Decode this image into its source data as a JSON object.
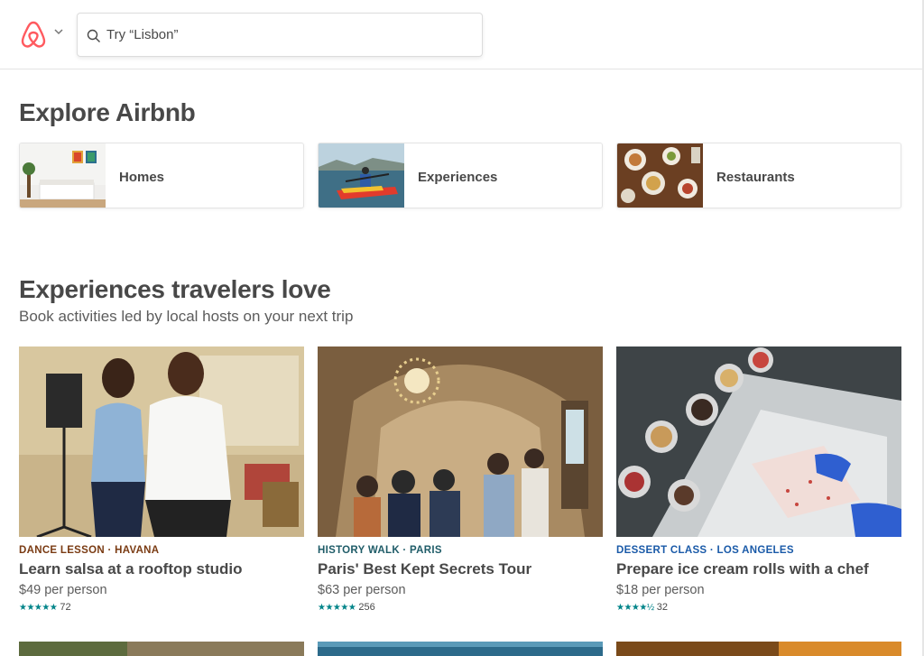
{
  "header": {
    "search_placeholder": "Try “Lisbon”"
  },
  "explore": {
    "title": "Explore Airbnb",
    "categories": [
      {
        "label": "Homes"
      },
      {
        "label": "Experiences"
      },
      {
        "label": "Restaurants"
      }
    ]
  },
  "experiences": {
    "title": "Experiences travelers love",
    "subtitle": "Book activities led by local hosts on your next trip",
    "cards": [
      {
        "kicker": "DANCE LESSON · HAVANA",
        "kicker_color": "#7a3b13",
        "name": "Learn salsa at a rooftop studio",
        "price": "$49 per person",
        "stars": "★★★★★",
        "rating_value": 5,
        "reviews": "72"
      },
      {
        "kicker": "HISTORY WALK · PARIS",
        "kicker_color": "#1f5c68",
        "name": "Paris' Best Kept Secrets Tour",
        "price": "$63 per person",
        "stars": "★★★★★",
        "rating_value": 5,
        "reviews": "256"
      },
      {
        "kicker": "DESSERT CLASS · LOS ANGELES",
        "kicker_color": "#1a5aa8",
        "name": "Prepare ice cream rolls with a chef",
        "price": "$18 per person",
        "stars": "★★★★½",
        "rating_value": 4.5,
        "reviews": "32"
      }
    ]
  },
  "colors": {
    "brand": "#FF5A5F",
    "accent": "#008489"
  }
}
